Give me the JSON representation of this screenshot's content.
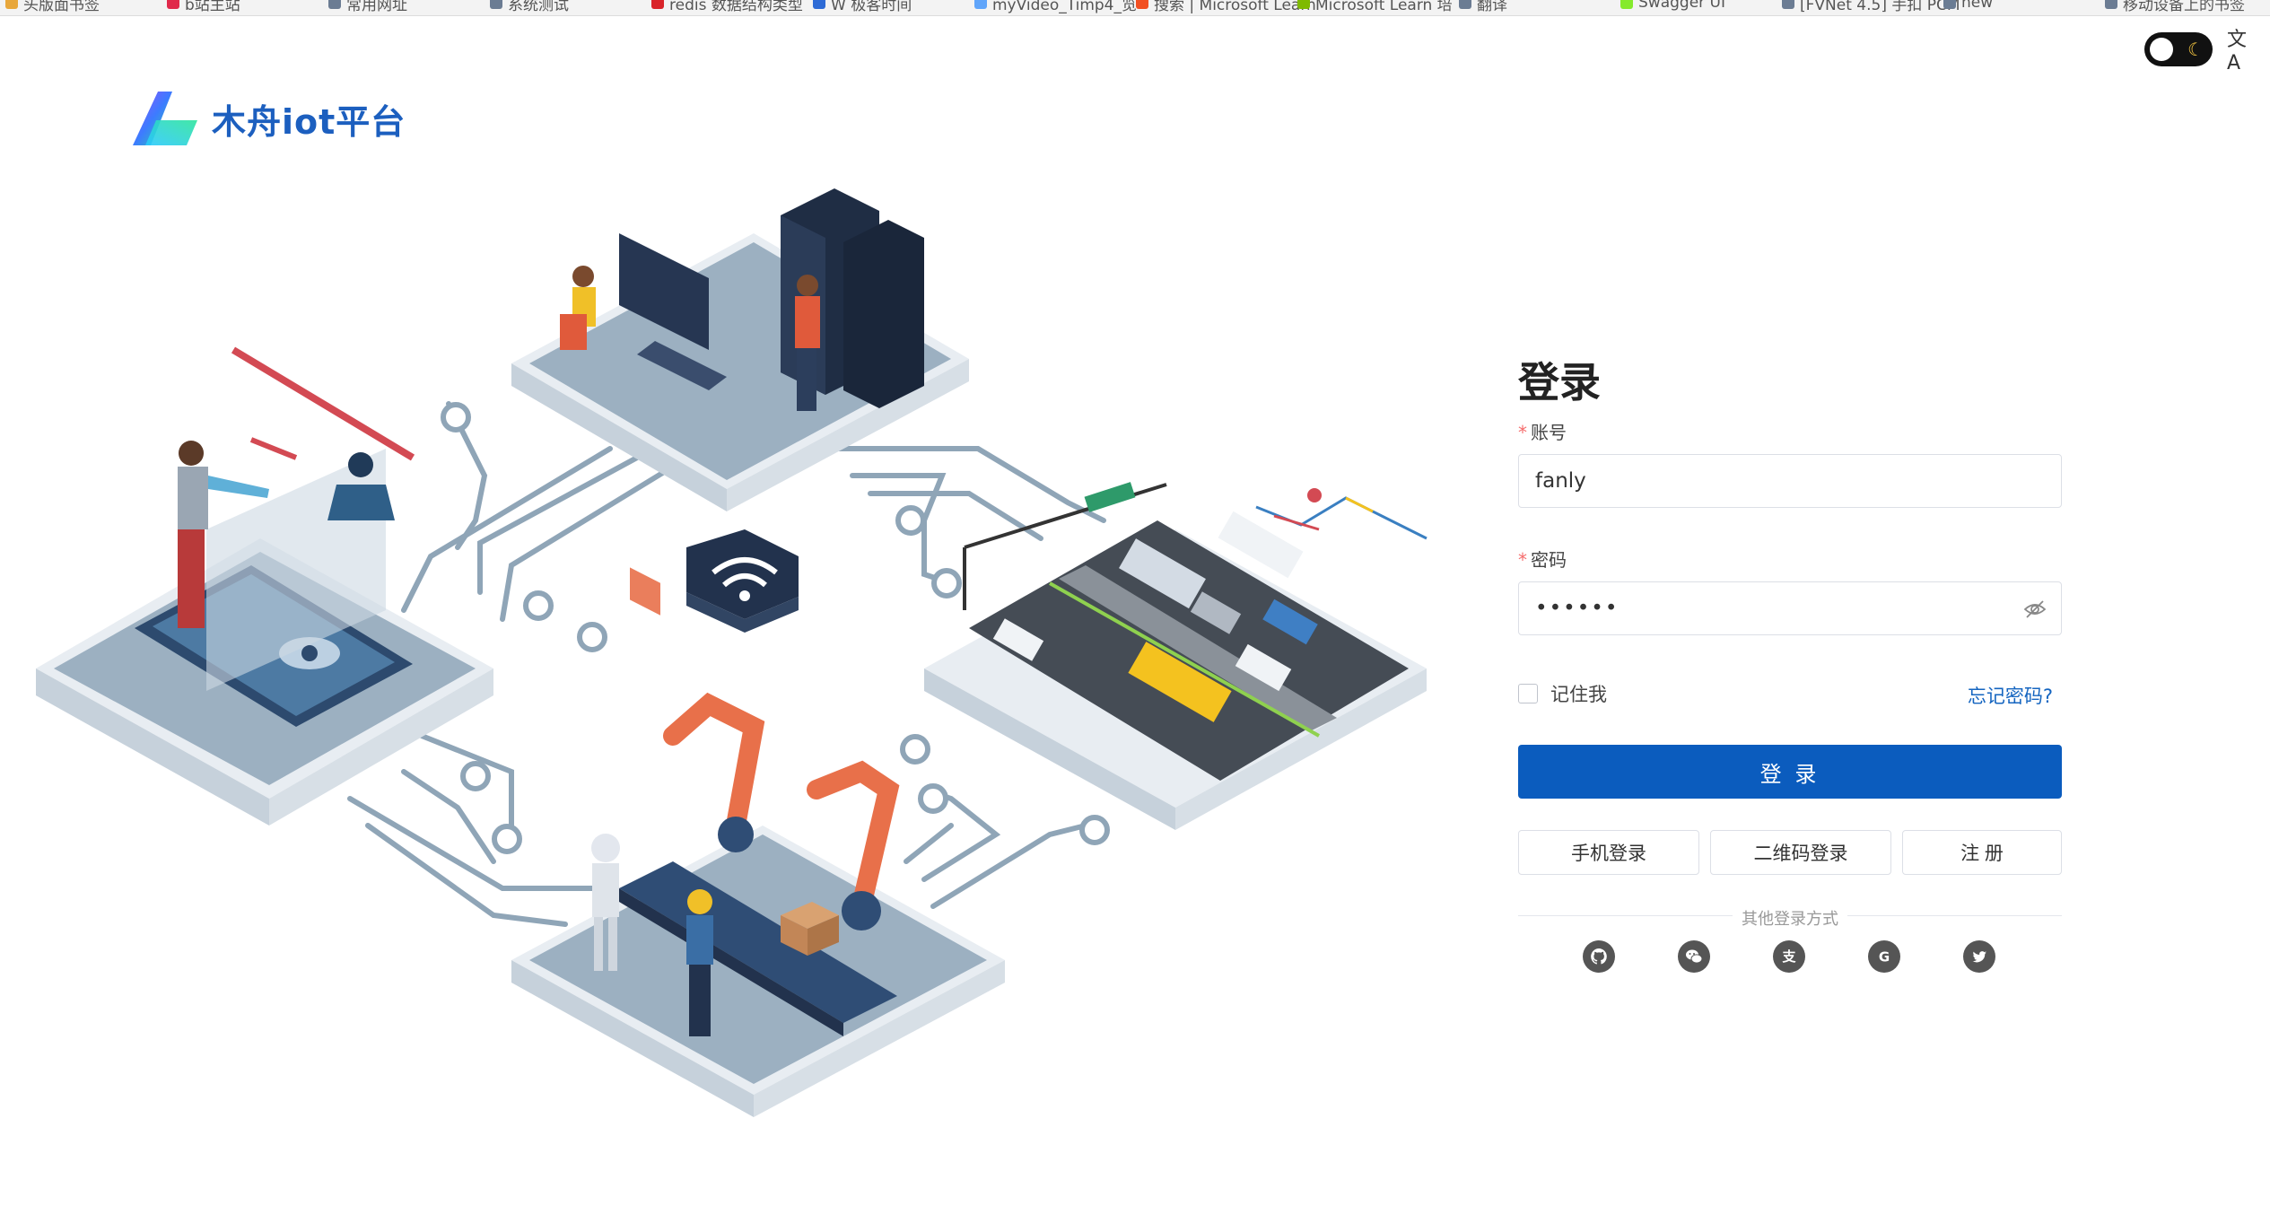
{
  "bookmarks": [
    {
      "label": "头版面书签",
      "color": "#e8a73b"
    },
    {
      "label": "b站主站",
      "color": "#e0294a"
    },
    {
      "label": "常用网址",
      "color": "#6b7c93"
    },
    {
      "label": "系统测试",
      "color": "#6b7c93"
    },
    {
      "label": "redis 数据结构类型",
      "color": "#d9242a"
    },
    {
      "label": "W 极客时间",
      "color": "#2e6bd6"
    },
    {
      "label": "myVideo_Timp4_览",
      "color": "#60a5fa"
    },
    {
      "label": "搜索 | Microsoft Learn",
      "color": "#f25022"
    },
    {
      "label": "Microsoft Learn 培",
      "color": "#7fba00"
    },
    {
      "label": "翻译",
      "color": "#6b7c93"
    },
    {
      "label": "Swagger UI",
      "color": "#85ea2d"
    },
    {
      "label": "[FVNet 4.5] 手扣 PCM",
      "color": "#6b7c93"
    },
    {
      "label": "new",
      "color": "#6b7c93"
    },
    {
      "label": "移动设备上的书签",
      "color": "#6b7c93"
    }
  ],
  "header": {
    "app_title": "木舟iot平台",
    "theme_icon": "moon-icon",
    "lang_icon": "translate-icon",
    "lang_glyph": "文A"
  },
  "login": {
    "title": "登录",
    "account_label": "账号",
    "account_value": "fanly",
    "password_label": "密码",
    "password_value": "••••••",
    "remember_label": "记住我",
    "forgot_label": "忘记密码?",
    "submit_label": "登 录",
    "phone_login_label": "手机登录",
    "qr_login_label": "二维码登录",
    "register_label": "注 册",
    "other_methods_label": "其他登录方式",
    "social": [
      "github-icon",
      "wechat-icon",
      "alipay-icon",
      "google-icon",
      "twitter-icon"
    ]
  },
  "colors": {
    "primary": "#0b5cbe",
    "brand_text": "#1c5fbf",
    "required": "#f56c6c",
    "link": "#1565c0"
  }
}
